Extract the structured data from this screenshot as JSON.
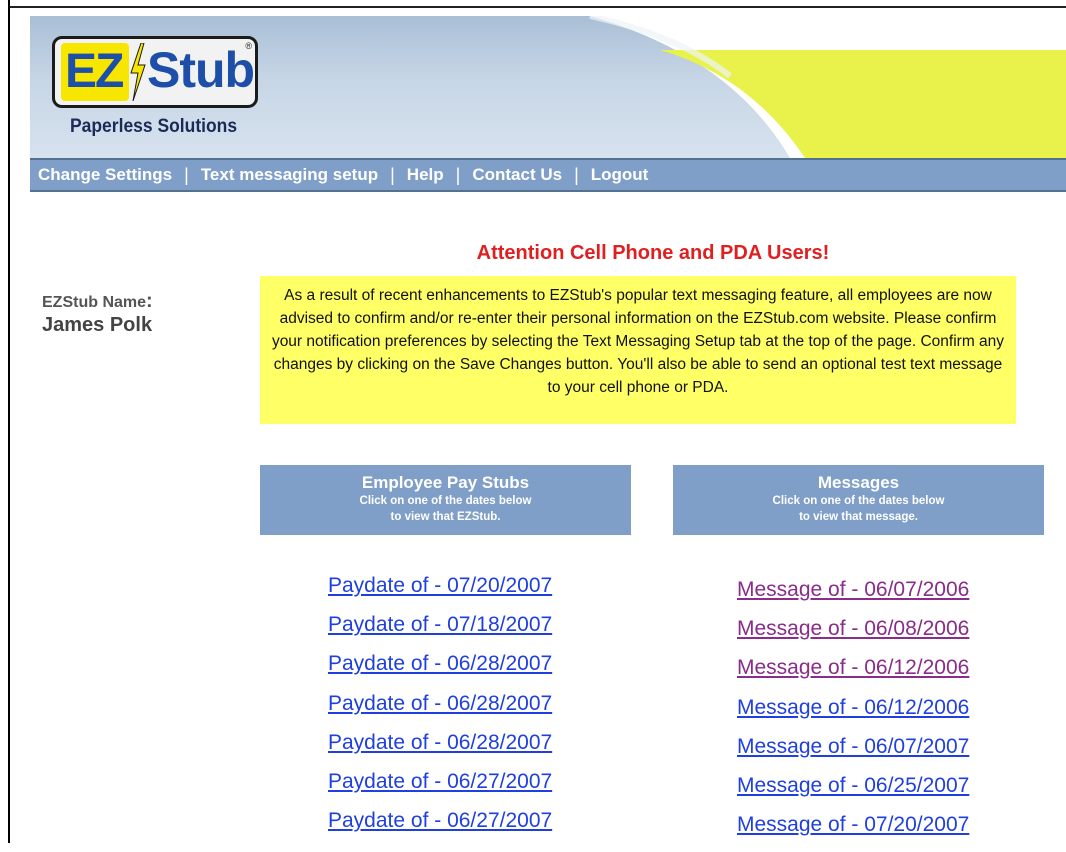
{
  "brand": {
    "logo_left": "EZ",
    "logo_right": "Stub",
    "registered": "®",
    "tagline": "Paperless Solutions",
    "colors": {
      "logo_yellow": "#f7e600",
      "logo_blue": "#1d4fa8",
      "banner_green": "#e8f24a",
      "nav_blue": "#7f9fc9"
    }
  },
  "nav": {
    "items": [
      "Change Settings",
      "Text messaging setup",
      "Help",
      "Contact Us",
      "Logout"
    ],
    "separator": "|"
  },
  "user": {
    "label": "EZStub Name",
    "colon": ":",
    "name": "James Polk"
  },
  "notice": {
    "title": "Attention Cell Phone and PDA Users!",
    "body": "As a result of recent enhancements to EZStub's popular text messaging feature, all employees are now advised to confirm and/or re-enter their personal information on the EZStub.com website. Please confirm your notification preferences by selecting the Text Messaging Setup tab at the top of the page. Confirm any changes by clicking on the Save Changes button. You'll also be able to send an optional test text message to your cell phone or PDA.",
    "colors": {
      "title": "#e02020",
      "background": "#ffff66"
    }
  },
  "pay_stubs": {
    "title": "Employee Pay Stubs",
    "subtitle_line1": "Click on one of the dates below",
    "subtitle_line2": "to view that EZStub.",
    "links": [
      "Paydate of - 07/20/2007",
      "Paydate of - 07/18/2007",
      "Paydate of - 06/28/2007",
      "Paydate of - 06/28/2007",
      "Paydate of - 06/28/2007",
      "Paydate of - 06/27/2007",
      "Paydate of - 06/27/2007"
    ]
  },
  "messages": {
    "title": "Messages",
    "subtitle_line1": "Click on one of the dates below",
    "subtitle_line2": "to view that message.",
    "links": [
      "Message of - 06/07/2006",
      "Message of - 06/08/2006",
      "Message of - 06/12/2006",
      "Message of - 06/12/2006",
      "Message of - 06/07/2007",
      "Message of - 06/25/2007",
      "Message of - 07/20/2007"
    ],
    "visited_count": 3
  }
}
